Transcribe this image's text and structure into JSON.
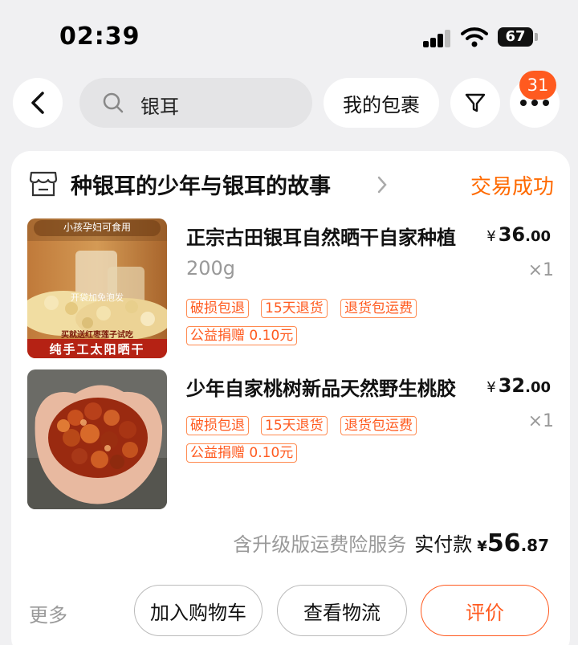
{
  "status_bar": {
    "time": "02:39",
    "battery": "67"
  },
  "nav": {
    "back_icon": "chevron-left-icon",
    "search_query": "银耳",
    "package_button": "我的包裹",
    "filter_icon": "filter-icon",
    "more_icon": "more-dots-icon",
    "badge_count": "31"
  },
  "order": {
    "shop_icon": "store-icon",
    "shop_name": "种银耳的少年与银耳的故事",
    "status": "交易成功",
    "items": [
      {
        "title": "正宗古田银耳自然晒干自家种植",
        "spec": "200g",
        "currency": "¥",
        "price_int": "36",
        "price_dec": ".00",
        "qty": "×1",
        "tags": [
          "破损包退",
          "15天退货",
          "退货包运费",
          "公益捐赠 0.10元"
        ],
        "image_texts": {
          "top": "小孩孕妇可食用",
          "middle": "开袋加免泡发",
          "gift": "买就送红枣莲子试吃",
          "bottom": "纯手工太阳晒干"
        }
      },
      {
        "title": "少年自家桃树新品天然野生桃胶",
        "spec": "",
        "currency": "¥",
        "price_int": "32",
        "price_dec": ".00",
        "qty": "×1",
        "tags": [
          "破损包退",
          "15天退货",
          "退货包运费",
          "公益捐赠 0.10元"
        ]
      }
    ],
    "summary": {
      "service_note": "含升级版运费险服务",
      "paid_label": "实付款",
      "currency": "¥",
      "total_int": "56",
      "total_dec": ".87"
    },
    "actions": {
      "more": "更多",
      "add_to_cart": "加入购物车",
      "view_logistics": "查看物流",
      "review": "评价"
    }
  },
  "colors": {
    "accent": "#ff5a1f",
    "status": "#ff6a00",
    "muted": "#999999"
  }
}
